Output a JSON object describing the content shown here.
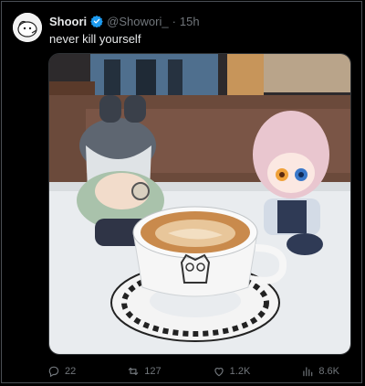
{
  "tweet": {
    "display_name": "Shoori",
    "handle": "@Showori_",
    "separator": "·",
    "time": "15h",
    "text": "never kill yourself",
    "verified_color": "#1d9bf0"
  },
  "actions": {
    "replies": "22",
    "retweets": "127",
    "likes": "1.2K",
    "views": "8.6K"
  },
  "icons": {
    "reply": "reply-icon",
    "retweet": "retweet-icon",
    "like": "heart-icon",
    "views": "views-icon"
  }
}
